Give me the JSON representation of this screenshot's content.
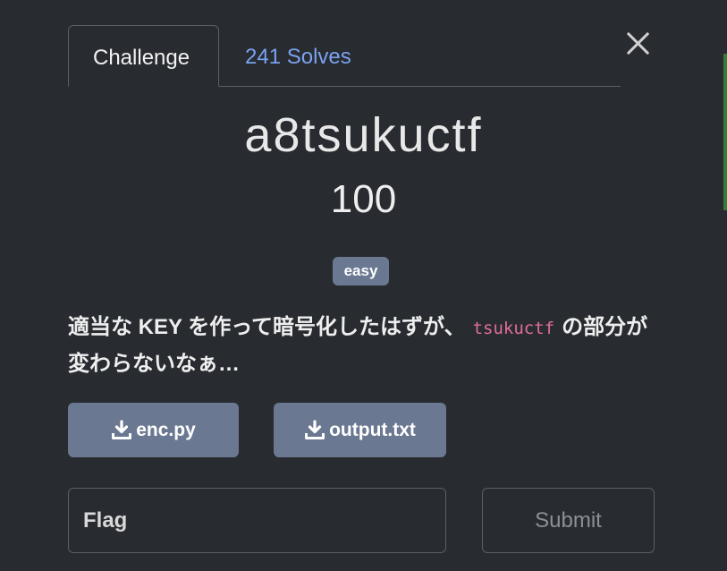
{
  "tabs": [
    {
      "label": "Challenge",
      "active": true
    },
    {
      "label": "241 Solves",
      "active": false
    }
  ],
  "challenge": {
    "name": "a8tsukuctf",
    "points": "100",
    "tag": "easy",
    "description_before": "適当な KEY を作って暗号化したはずが、",
    "description_code": "tsukuctf",
    "description_after": "の部分が変わらないなぁ…"
  },
  "files": [
    {
      "name": "enc.py",
      "icon": "download-icon"
    },
    {
      "name": "output.txt",
      "icon": "download-icon"
    }
  ],
  "form": {
    "flag_placeholder": "Flag",
    "flag_value": "",
    "submit_label": "Submit"
  },
  "colors": {
    "background": "#282b30",
    "tag": "#6a7892",
    "button": "#6b7892",
    "link": "#7aa2f0",
    "code": "#e06c9f"
  }
}
